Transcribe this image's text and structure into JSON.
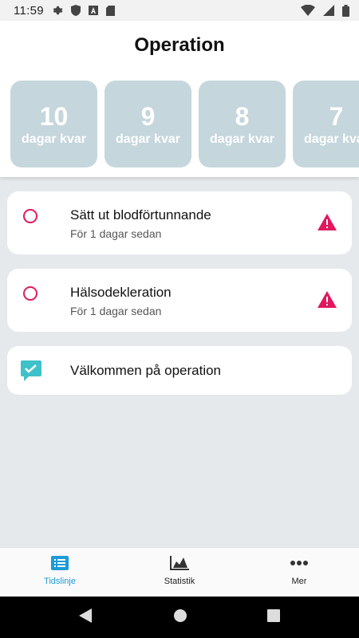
{
  "status_bar": {
    "time": "11:59"
  },
  "header": {
    "title": "Operation",
    "days": [
      {
        "number": "10",
        "label": "dagar kvar"
      },
      {
        "number": "9",
        "label": "dagar kvar"
      },
      {
        "number": "8",
        "label": "dagar kvar"
      },
      {
        "number": "7",
        "label": "dagar kvar"
      }
    ]
  },
  "tasks": [
    {
      "title": "Sätt ut blodförtunnande",
      "subtitle": "För 1 dagar sedan"
    },
    {
      "title": "Hälsodekleration",
      "subtitle": "För 1 dagar sedan"
    },
    {
      "title": "Välkommen på operation"
    }
  ],
  "bottom_nav": {
    "items": [
      {
        "label": "Tidslinje",
        "icon": "list-icon",
        "active": true
      },
      {
        "label": "Statistik",
        "icon": "chart-icon",
        "active": false
      },
      {
        "label": "Mer",
        "icon": "more-icon",
        "active": false
      }
    ]
  },
  "colors": {
    "accent": "#1d9bd6",
    "alert": "#e0195e",
    "card": "#c5d6dc",
    "check": "#3fc1c9"
  }
}
